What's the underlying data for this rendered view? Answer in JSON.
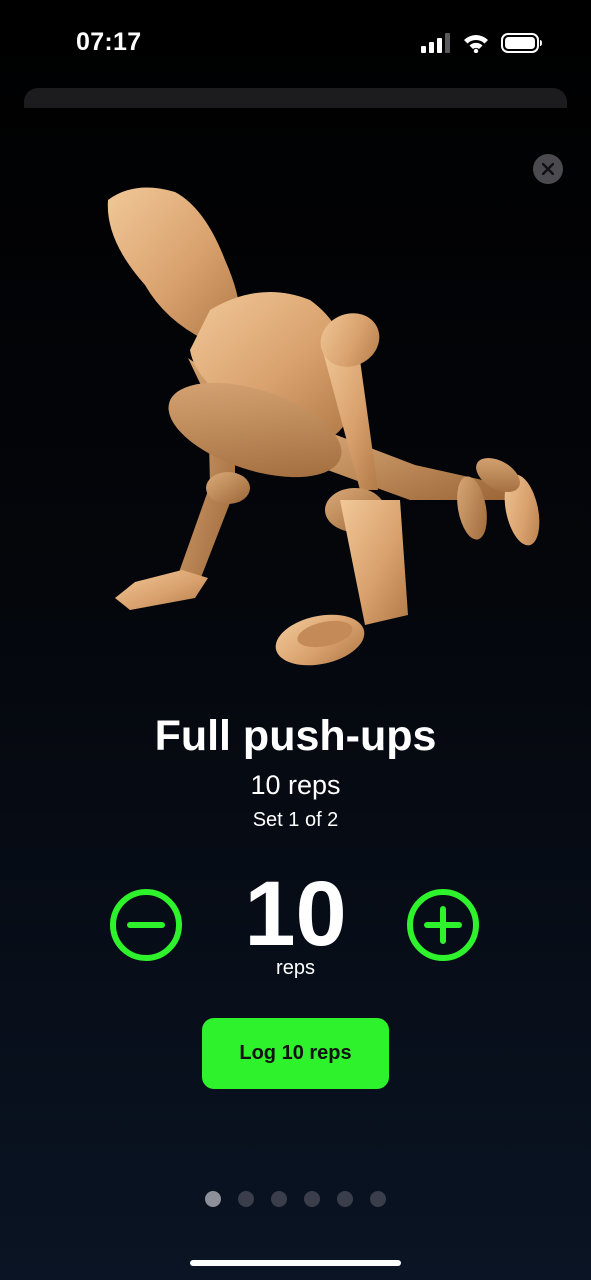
{
  "status_bar": {
    "time": "07:17",
    "icons": [
      "cellular-signal-icon",
      "wifi-icon",
      "battery-icon"
    ]
  },
  "exercise": {
    "title": "Full push-ups",
    "target": "10 reps",
    "set_label": "Set 1 of 2",
    "image": "wooden-mannequin-pushup-figure"
  },
  "counter": {
    "value": "10",
    "unit": "reps",
    "decrement_icon": "minus-circle-icon",
    "increment_icon": "plus-circle-icon"
  },
  "log_button": {
    "label": "Log 10 reps"
  },
  "pagination": {
    "total": 6,
    "current": 1
  },
  "colors": {
    "accent": "#2ef22c",
    "background": "#000000",
    "close_button_bg": "#4b4b4f"
  }
}
